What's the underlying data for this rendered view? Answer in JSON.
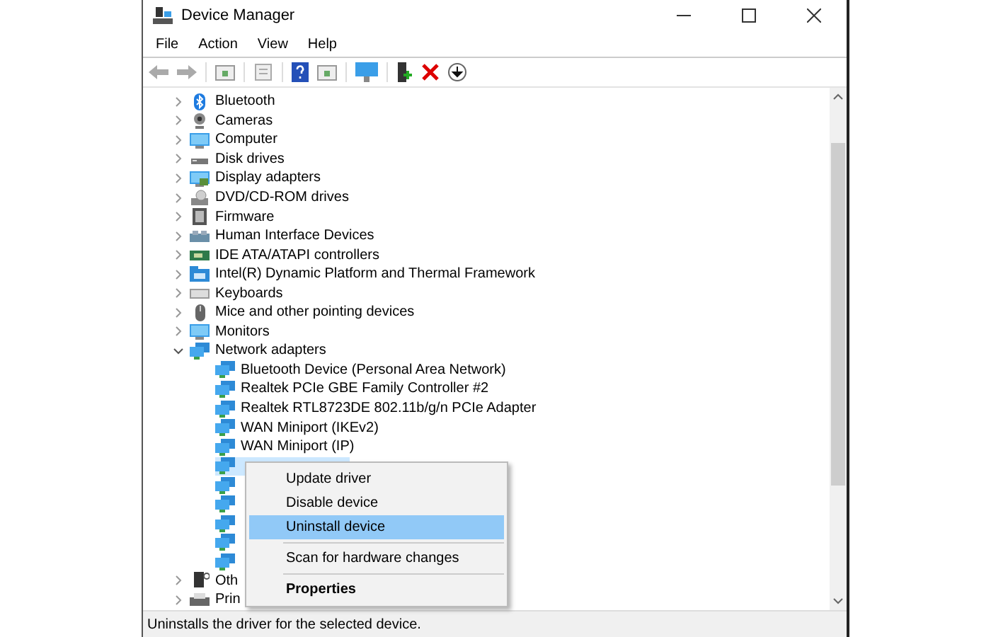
{
  "window": {
    "title": "Device Manager"
  },
  "menu": [
    "File",
    "Action",
    "View",
    "Help"
  ],
  "tree": [
    {
      "label": "Bluetooth",
      "expanded": false,
      "selected": false
    },
    {
      "label": "Cameras",
      "expanded": false,
      "selected": false
    },
    {
      "label": "Computer",
      "expanded": false,
      "selected": false
    },
    {
      "label": "Disk drives",
      "expanded": false,
      "selected": false
    },
    {
      "label": "Display adapters",
      "expanded": false,
      "selected": false
    },
    {
      "label": "DVD/CD-ROM drives",
      "expanded": false,
      "selected": false
    },
    {
      "label": "Firmware",
      "expanded": false,
      "selected": false
    },
    {
      "label": "Human Interface Devices",
      "expanded": false,
      "selected": false
    },
    {
      "label": "IDE ATA/ATAPI controllers",
      "expanded": false,
      "selected": false
    },
    {
      "label": "Intel(R) Dynamic Platform and Thermal Framework",
      "expanded": false,
      "selected": false
    },
    {
      "label": "Keyboards",
      "expanded": false,
      "selected": false
    },
    {
      "label": "Mice and other pointing devices",
      "expanded": false,
      "selected": false
    },
    {
      "label": "Monitors",
      "expanded": false,
      "selected": false
    },
    {
      "label": "Network adapters",
      "expanded": true,
      "selected": false,
      "children": [
        {
          "label": "Bluetooth Device (Personal Area Network)",
          "selected": false
        },
        {
          "label": "Realtek PCIe GBE Family Controller #2",
          "selected": false
        },
        {
          "label": "Realtek RTL8723DE 802.11b/g/n PCIe Adapter",
          "selected": false
        },
        {
          "label": "WAN Miniport (IKEv2)",
          "selected": false
        },
        {
          "label": "WAN Miniport (IP)",
          "selected": false
        },
        {
          "selected": true
        },
        {
          "selected": false
        },
        {
          "selected": false
        },
        {
          "selected": false
        },
        {
          "selected": false
        },
        {
          "selected": false
        }
      ]
    },
    {
      "label": "Oth",
      "expanded": false,
      "selected": false
    },
    {
      "label": "Prin",
      "expanded": false,
      "selected": false
    }
  ],
  "context_menu": [
    {
      "kind": "item",
      "label": "Update driver",
      "selected": false,
      "bold": false
    },
    {
      "kind": "item",
      "label": "Disable device",
      "selected": false,
      "bold": false
    },
    {
      "kind": "item",
      "label": "Uninstall device",
      "selected": true,
      "bold": false
    },
    {
      "kind": "separator"
    },
    {
      "kind": "item",
      "label": "Scan for hardware changes",
      "selected": false,
      "bold": false
    },
    {
      "kind": "separator"
    },
    {
      "kind": "item",
      "label": "Properties",
      "selected": false,
      "bold": true
    }
  ],
  "status_bar": "Uninstalls the driver for the selected device."
}
